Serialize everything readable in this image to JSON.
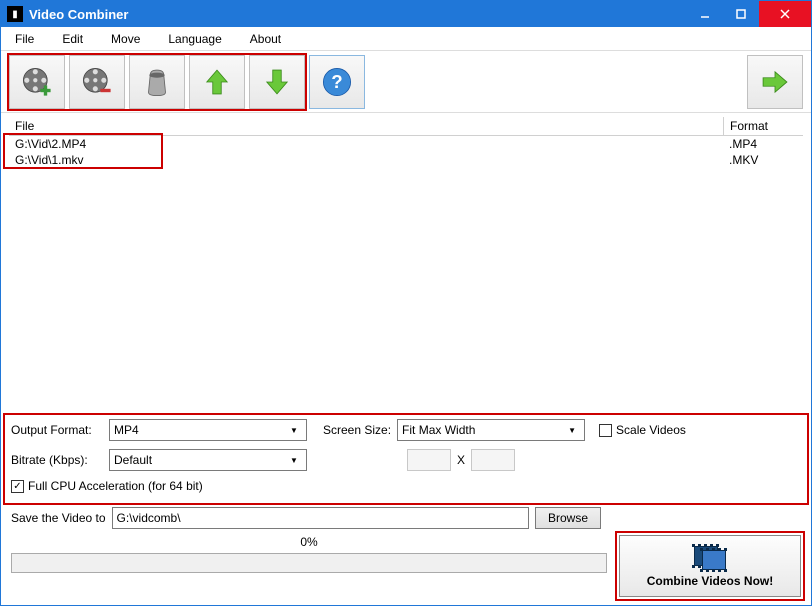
{
  "window": {
    "title": "Video Combiner"
  },
  "menu": {
    "file": "File",
    "edit": "Edit",
    "move": "Move",
    "language": "Language",
    "about": "About"
  },
  "toolbar": {
    "add": "add-video",
    "remove": "remove-video",
    "clear": "clear-list",
    "up": "move-up",
    "down": "move-down",
    "help": "help",
    "go": "go"
  },
  "columns": {
    "file": "File",
    "format": "Format"
  },
  "files": [
    {
      "path": "G:\\Vid\\2.MP4",
      "format": ".MP4"
    },
    {
      "path": "G:\\Vid\\1.mkv",
      "format": ".MKV"
    }
  ],
  "settings": {
    "output_format_label": "Output Format:",
    "output_format": "MP4",
    "screen_size_label": "Screen Size:",
    "screen_size": "Fit Max Width",
    "scale_videos_label": "Scale Videos",
    "scale_videos_checked": false,
    "bitrate_label": "Bitrate (Kbps):",
    "bitrate": "Default",
    "x_label": "X",
    "cpu_label": "Full CPU Acceleration (for 64 bit)",
    "cpu_checked": true
  },
  "save": {
    "label": "Save the Video to",
    "path": "G:\\vidcomb\\",
    "browse": "Browse"
  },
  "progress": {
    "percent": "0%"
  },
  "action": {
    "combine": "Combine Videos Now!"
  }
}
